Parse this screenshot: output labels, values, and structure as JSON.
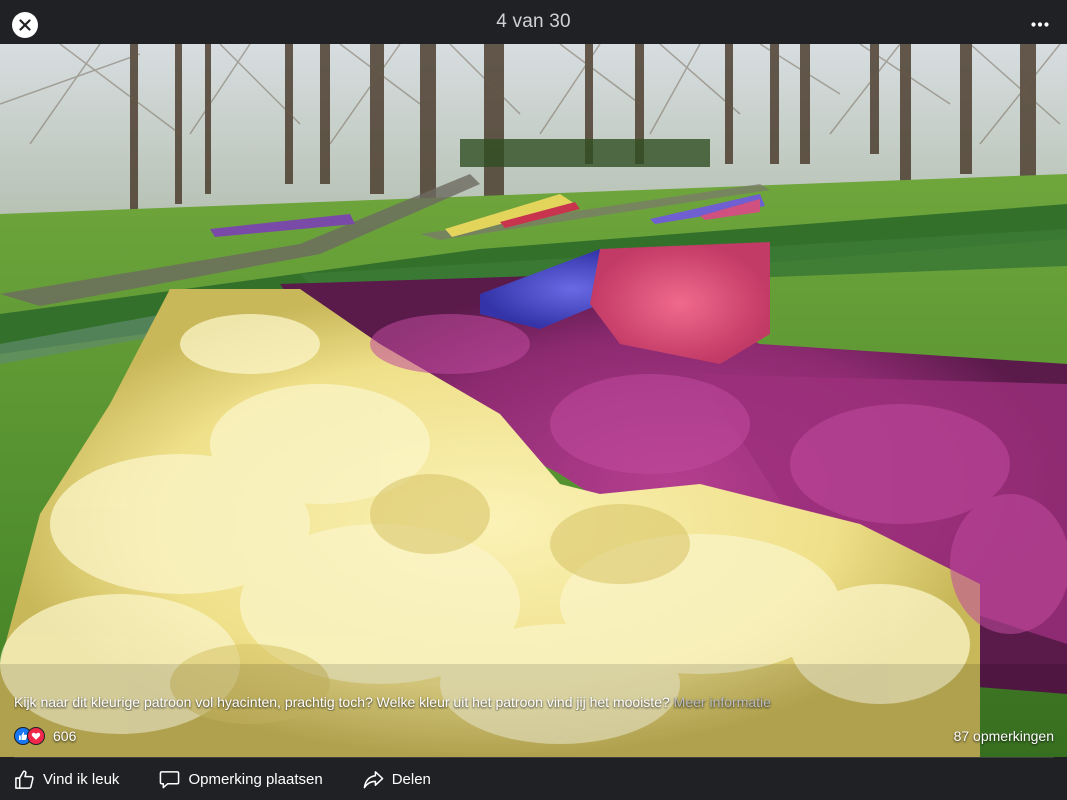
{
  "viewer": {
    "counter": "4 van 30",
    "close_icon": "close-icon",
    "more_icon": "more-dots-icon"
  },
  "post": {
    "caption": "Kijk naar dit kleurige patroon vol hyacinten, prachtig toch? Welke kleur uit het patroon vind jij het mooiste?",
    "more_link": "Meer informatie",
    "reaction_count": "606",
    "comment_count": "87 opmerkingen",
    "reactions": [
      "like-reaction-icon",
      "love-reaction-icon"
    ]
  },
  "actions": {
    "like": "Vind ik leuk",
    "comment": "Opmerking plaatsen",
    "share": "Delen"
  },
  "colors": {
    "bar_background": "#202124",
    "like_blue": "#1877f2",
    "love_red": "#f02849"
  }
}
